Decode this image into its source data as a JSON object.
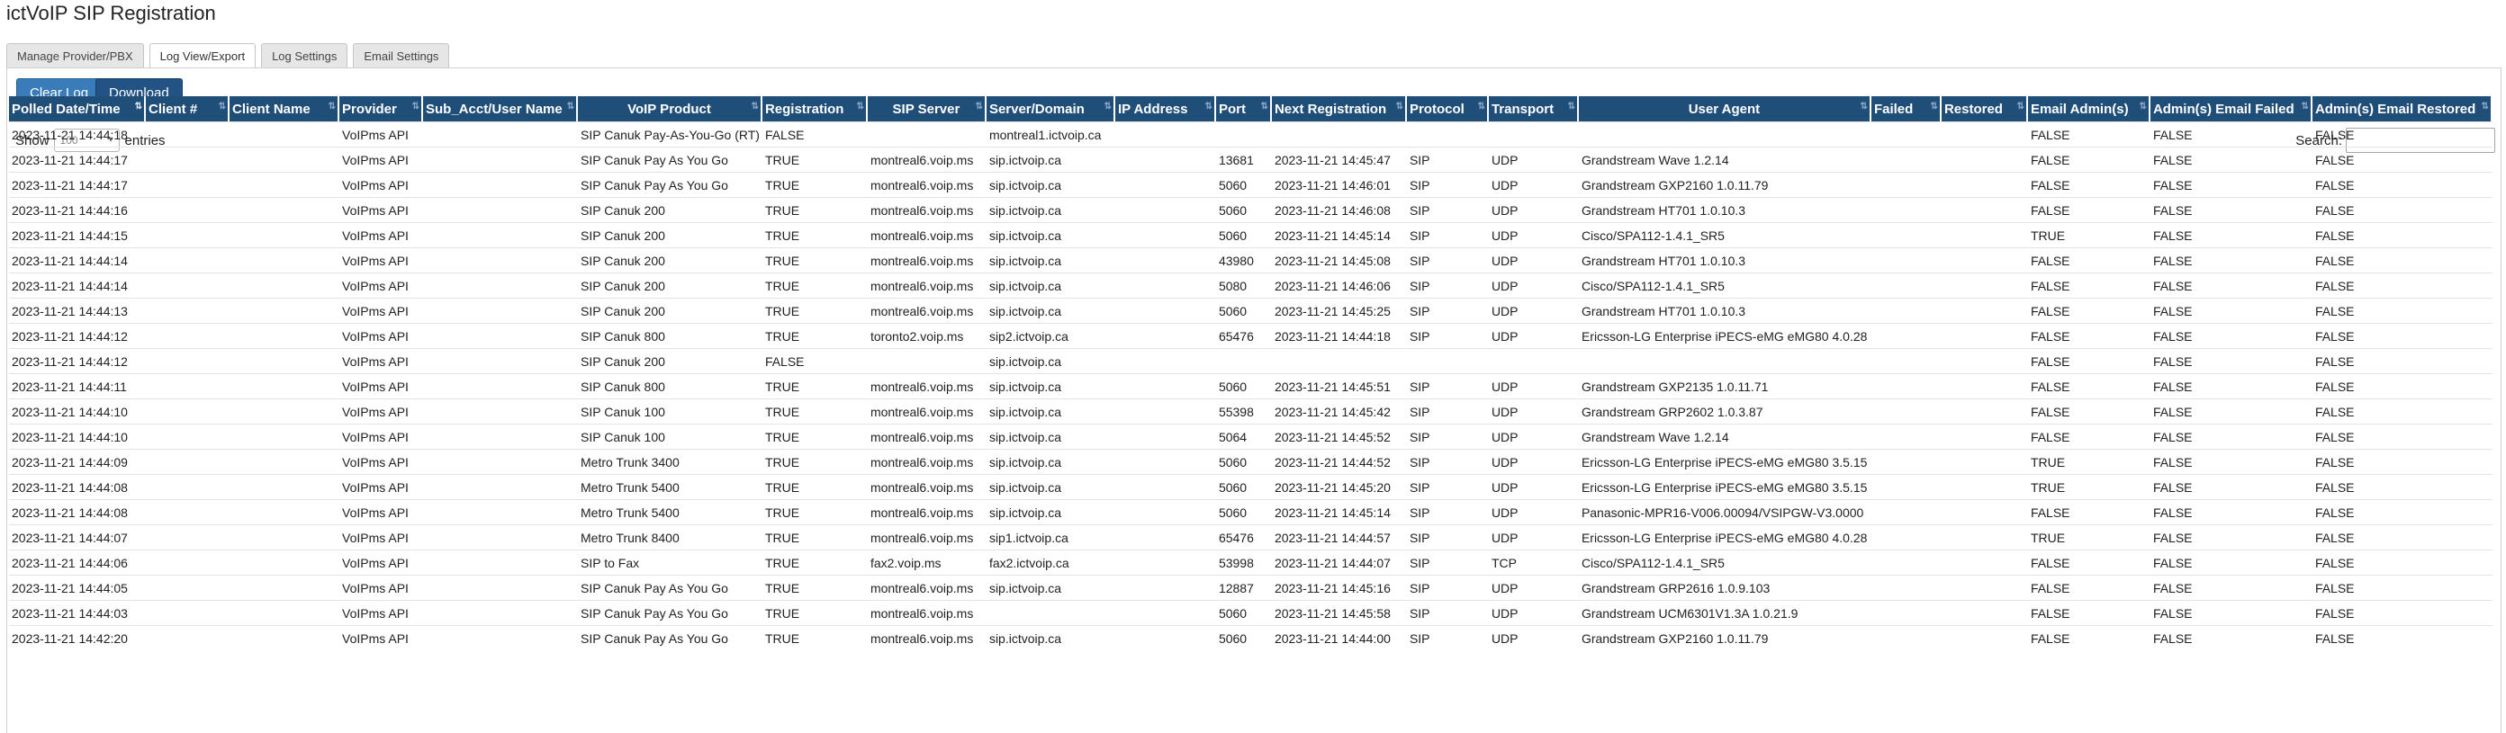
{
  "app": {
    "title": "ictVoIP SIP Registration"
  },
  "tabs": [
    {
      "label": "Manage Provider/PBX",
      "active": false
    },
    {
      "label": "Log View/Export",
      "active": true
    },
    {
      "label": "Log Settings",
      "active": false
    },
    {
      "label": "Email Settings",
      "active": false
    }
  ],
  "toolbar": {
    "clear_label": "Clear Log",
    "download_label": "Download"
  },
  "length": {
    "show_label": "Show",
    "value": "100",
    "entries_label": "entries"
  },
  "search": {
    "label": "Search:",
    "value": ""
  },
  "table": {
    "sorted_column": "Polled Date/Time",
    "columns": [
      "Polled Date/Time",
      "Client #",
      "Client Name",
      "Provider",
      "Sub_Acct/User Name",
      "VoIP Product",
      "Registration",
      "SIP Server",
      "Server/Domain",
      "IP Address",
      "Port",
      "Next Registration",
      "Protocol",
      "Transport",
      "User Agent",
      "Failed",
      "Restored",
      "Email Admin(s)",
      "Admin(s) Email Failed",
      "Admin(s) Email Restored"
    ],
    "rows": [
      [
        "2023-11-21 14:44:18",
        "",
        "",
        "VoIPms API",
        "",
        "SIP Canuk Pay-As-You-Go (RT)",
        "FALSE",
        "",
        "montreal1.ictvoip.ca",
        "",
        "",
        "",
        "",
        "",
        "",
        "",
        "",
        "FALSE",
        "FALSE",
        "FALSE"
      ],
      [
        "2023-11-21 14:44:17",
        "",
        "",
        "VoIPms API",
        "",
        "SIP Canuk Pay As You Go",
        "TRUE",
        "montreal6.voip.ms",
        "sip.ictvoip.ca",
        "",
        "13681",
        "2023-11-21 14:45:47",
        "SIP",
        "UDP",
        "Grandstream Wave 1.2.14",
        "",
        "",
        "FALSE",
        "FALSE",
        "FALSE"
      ],
      [
        "2023-11-21 14:44:17",
        "",
        "",
        "VoIPms API",
        "",
        "SIP Canuk Pay As You Go",
        "TRUE",
        "montreal6.voip.ms",
        "sip.ictvoip.ca",
        "",
        "5060",
        "2023-11-21 14:46:01",
        "SIP",
        "UDP",
        "Grandstream GXP2160 1.0.11.79",
        "",
        "",
        "FALSE",
        "FALSE",
        "FALSE"
      ],
      [
        "2023-11-21 14:44:16",
        "",
        "",
        "VoIPms API",
        "",
        "SIP Canuk 200",
        "TRUE",
        "montreal6.voip.ms",
        "sip.ictvoip.ca",
        "",
        "5060",
        "2023-11-21 14:46:08",
        "SIP",
        "UDP",
        "Grandstream HT701 1.0.10.3",
        "",
        "",
        "FALSE",
        "FALSE",
        "FALSE"
      ],
      [
        "2023-11-21 14:44:15",
        "",
        "",
        "VoIPms API",
        "",
        "SIP Canuk 200",
        "TRUE",
        "montreal6.voip.ms",
        "sip.ictvoip.ca",
        "",
        "5060",
        "2023-11-21 14:45:14",
        "SIP",
        "UDP",
        "Cisco/SPA112-1.4.1_SR5",
        "",
        "",
        "TRUE",
        "FALSE",
        "FALSE"
      ],
      [
        "2023-11-21 14:44:14",
        "",
        "",
        "VoIPms API",
        "",
        "SIP Canuk 200",
        "TRUE",
        "montreal6.voip.ms",
        "sip.ictvoip.ca",
        "",
        "43980",
        "2023-11-21 14:45:08",
        "SIP",
        "UDP",
        "Grandstream HT701 1.0.10.3",
        "",
        "",
        "FALSE",
        "FALSE",
        "FALSE"
      ],
      [
        "2023-11-21 14:44:14",
        "",
        "",
        "VoIPms API",
        "",
        "SIP Canuk 200",
        "TRUE",
        "montreal6.voip.ms",
        "sip.ictvoip.ca",
        "",
        "5080",
        "2023-11-21 14:46:06",
        "SIP",
        "UDP",
        "Cisco/SPA112-1.4.1_SR5",
        "",
        "",
        "FALSE",
        "FALSE",
        "FALSE"
      ],
      [
        "2023-11-21 14:44:13",
        "",
        "",
        "VoIPms API",
        "",
        "SIP Canuk 200",
        "TRUE",
        "montreal6.voip.ms",
        "sip.ictvoip.ca",
        "",
        "5060",
        "2023-11-21 14:45:25",
        "SIP",
        "UDP",
        "Grandstream HT701 1.0.10.3",
        "",
        "",
        "FALSE",
        "FALSE",
        "FALSE"
      ],
      [
        "2023-11-21 14:44:12",
        "",
        "",
        "VoIPms API",
        "",
        "SIP Canuk 800",
        "TRUE",
        "toronto2.voip.ms",
        "sip2.ictvoip.ca",
        "",
        "65476",
        "2023-11-21 14:44:18",
        "SIP",
        "UDP",
        "Ericsson-LG Enterprise iPECS-eMG eMG80 4.0.28",
        "",
        "",
        "FALSE",
        "FALSE",
        "FALSE"
      ],
      [
        "2023-11-21 14:44:12",
        "",
        "",
        "VoIPms API",
        "",
        "SIP Canuk 200",
        "FALSE",
        "",
        "sip.ictvoip.ca",
        "",
        "",
        "",
        "",
        "",
        "",
        "",
        "",
        "FALSE",
        "FALSE",
        "FALSE"
      ],
      [
        "2023-11-21 14:44:11",
        "",
        "",
        "VoIPms API",
        "",
        "SIP Canuk 800",
        "TRUE",
        "montreal6.voip.ms",
        "sip.ictvoip.ca",
        "",
        "5060",
        "2023-11-21 14:45:51",
        "SIP",
        "UDP",
        "Grandstream GXP2135 1.0.11.71",
        "",
        "",
        "FALSE",
        "FALSE",
        "FALSE"
      ],
      [
        "2023-11-21 14:44:10",
        "",
        "",
        "VoIPms API",
        "",
        "SIP Canuk 100",
        "TRUE",
        "montreal6.voip.ms",
        "sip.ictvoip.ca",
        "",
        "55398",
        "2023-11-21 14:45:42",
        "SIP",
        "UDP",
        "Grandstream GRP2602 1.0.3.87",
        "",
        "",
        "FALSE",
        "FALSE",
        "FALSE"
      ],
      [
        "2023-11-21 14:44:10",
        "",
        "",
        "VoIPms API",
        "",
        "SIP Canuk 100",
        "TRUE",
        "montreal6.voip.ms",
        "sip.ictvoip.ca",
        "",
        "5064",
        "2023-11-21 14:45:52",
        "SIP",
        "UDP",
        "Grandstream Wave 1.2.14",
        "",
        "",
        "FALSE",
        "FALSE",
        "FALSE"
      ],
      [
        "2023-11-21 14:44:09",
        "",
        "",
        "VoIPms API",
        "",
        "Metro Trunk 3400",
        "TRUE",
        "montreal6.voip.ms",
        "sip.ictvoip.ca",
        "",
        "5060",
        "2023-11-21 14:44:52",
        "SIP",
        "UDP",
        "Ericsson-LG Enterprise iPECS-eMG eMG80 3.5.15",
        "",
        "",
        "TRUE",
        "FALSE",
        "FALSE"
      ],
      [
        "2023-11-21 14:44:08",
        "",
        "",
        "VoIPms API",
        "",
        "Metro Trunk 5400",
        "TRUE",
        "montreal6.voip.ms",
        "sip.ictvoip.ca",
        "",
        "5060",
        "2023-11-21 14:45:20",
        "SIP",
        "UDP",
        "Ericsson-LG Enterprise iPECS-eMG eMG80 3.5.15",
        "",
        "",
        "TRUE",
        "FALSE",
        "FALSE"
      ],
      [
        "2023-11-21 14:44:08",
        "",
        "",
        "VoIPms API",
        "",
        "Metro Trunk 5400",
        "TRUE",
        "montreal6.voip.ms",
        "sip.ictvoip.ca",
        "",
        "5060",
        "2023-11-21 14:45:14",
        "SIP",
        "UDP",
        "Panasonic-MPR16-V006.00094/VSIPGW-V3.0000",
        "",
        "",
        "FALSE",
        "FALSE",
        "FALSE"
      ],
      [
        "2023-11-21 14:44:07",
        "",
        "",
        "VoIPms API",
        "",
        "Metro Trunk 8400",
        "TRUE",
        "montreal6.voip.ms",
        "sip1.ictvoip.ca",
        "",
        "65476",
        "2023-11-21 14:44:57",
        "SIP",
        "UDP",
        "Ericsson-LG Enterprise iPECS-eMG eMG80 4.0.28",
        "",
        "",
        "TRUE",
        "FALSE",
        "FALSE"
      ],
      [
        "2023-11-21 14:44:06",
        "",
        "",
        "VoIPms API",
        "",
        "SIP to Fax",
        "TRUE",
        "fax2.voip.ms",
        "fax2.ictvoip.ca",
        "",
        "53998",
        "2023-11-21 14:44:07",
        "SIP",
        "TCP",
        "Cisco/SPA112-1.4.1_SR5",
        "",
        "",
        "FALSE",
        "FALSE",
        "FALSE"
      ],
      [
        "2023-11-21 14:44:05",
        "",
        "",
        "VoIPms API",
        "",
        "SIP Canuk Pay As You Go",
        "TRUE",
        "montreal6.voip.ms",
        "sip.ictvoip.ca",
        "",
        "12887",
        "2023-11-21 14:45:16",
        "SIP",
        "UDP",
        "Grandstream GRP2616 1.0.9.103",
        "",
        "",
        "FALSE",
        "FALSE",
        "FALSE"
      ],
      [
        "2023-11-21 14:44:03",
        "",
        "",
        "VoIPms API",
        "",
        "SIP Canuk Pay As You Go",
        "TRUE",
        "montreal6.voip.ms",
        "",
        "",
        "5060",
        "2023-11-21 14:45:58",
        "SIP",
        "UDP",
        "Grandstream UCM6301V1.3A 1.0.21.9",
        "",
        "",
        "FALSE",
        "FALSE",
        "FALSE"
      ],
      [
        "2023-11-21 14:42:20",
        "",
        "",
        "VoIPms API",
        "",
        "SIP Canuk Pay As You Go",
        "TRUE",
        "montreal6.voip.ms",
        "sip.ictvoip.ca",
        "",
        "5060",
        "2023-11-21 14:44:00",
        "SIP",
        "UDP",
        "Grandstream GXP2160 1.0.11.79",
        "",
        "",
        "FALSE",
        "FALSE",
        "FALSE"
      ]
    ]
  }
}
